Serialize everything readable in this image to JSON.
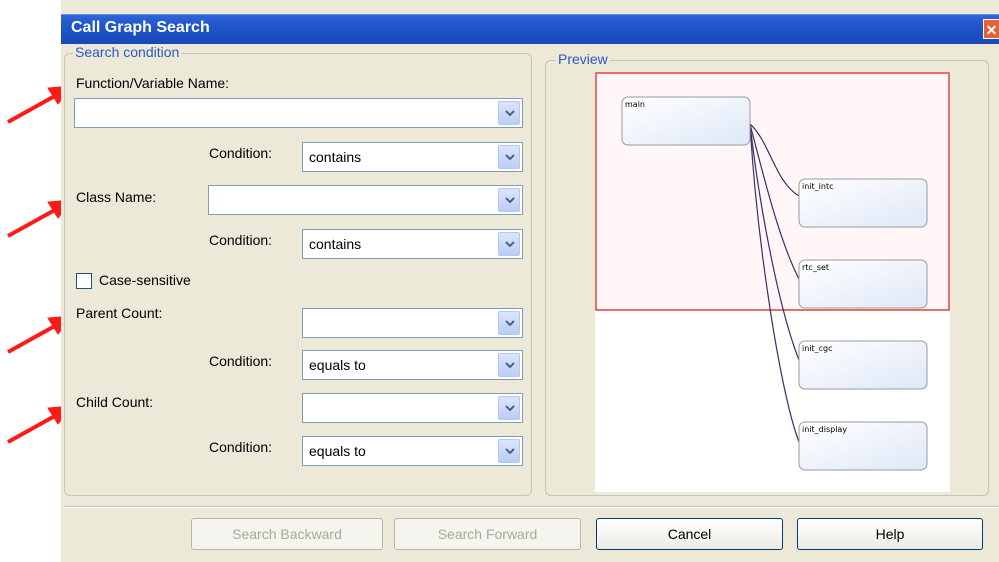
{
  "window": {
    "title": "Call Graph Search"
  },
  "search_condition": {
    "legend": "Search condition",
    "function_name": {
      "label": "Function/Variable Name:",
      "value": ""
    },
    "function_condition": {
      "label": "Condition:",
      "value": "contains"
    },
    "class_name": {
      "label": "Class Name:",
      "value": ""
    },
    "class_condition": {
      "label": "Condition:",
      "value": "contains"
    },
    "case_sensitive": {
      "label": "Case-sensitive",
      "checked": false
    },
    "parent_count": {
      "label": "Parent Count:",
      "value": ""
    },
    "parent_condition": {
      "label": "Condition:",
      "value": "equals to"
    },
    "child_count": {
      "label": "Child Count:",
      "value": ""
    },
    "child_condition": {
      "label": "Condition:",
      "value": "equals to"
    }
  },
  "preview": {
    "legend": "Preview",
    "nodes": [
      "main",
      "init_intc",
      "rtc_set",
      "init_cgc",
      "init_display"
    ]
  },
  "buttons": {
    "search_backward": "Search Backward",
    "search_forward": "Search Forward",
    "cancel": "Cancel",
    "help": "Help"
  },
  "colors": {
    "accent_arrow": "#ff0000",
    "title_bar": "#1f54c8",
    "group_legend": "#2a58c8"
  }
}
